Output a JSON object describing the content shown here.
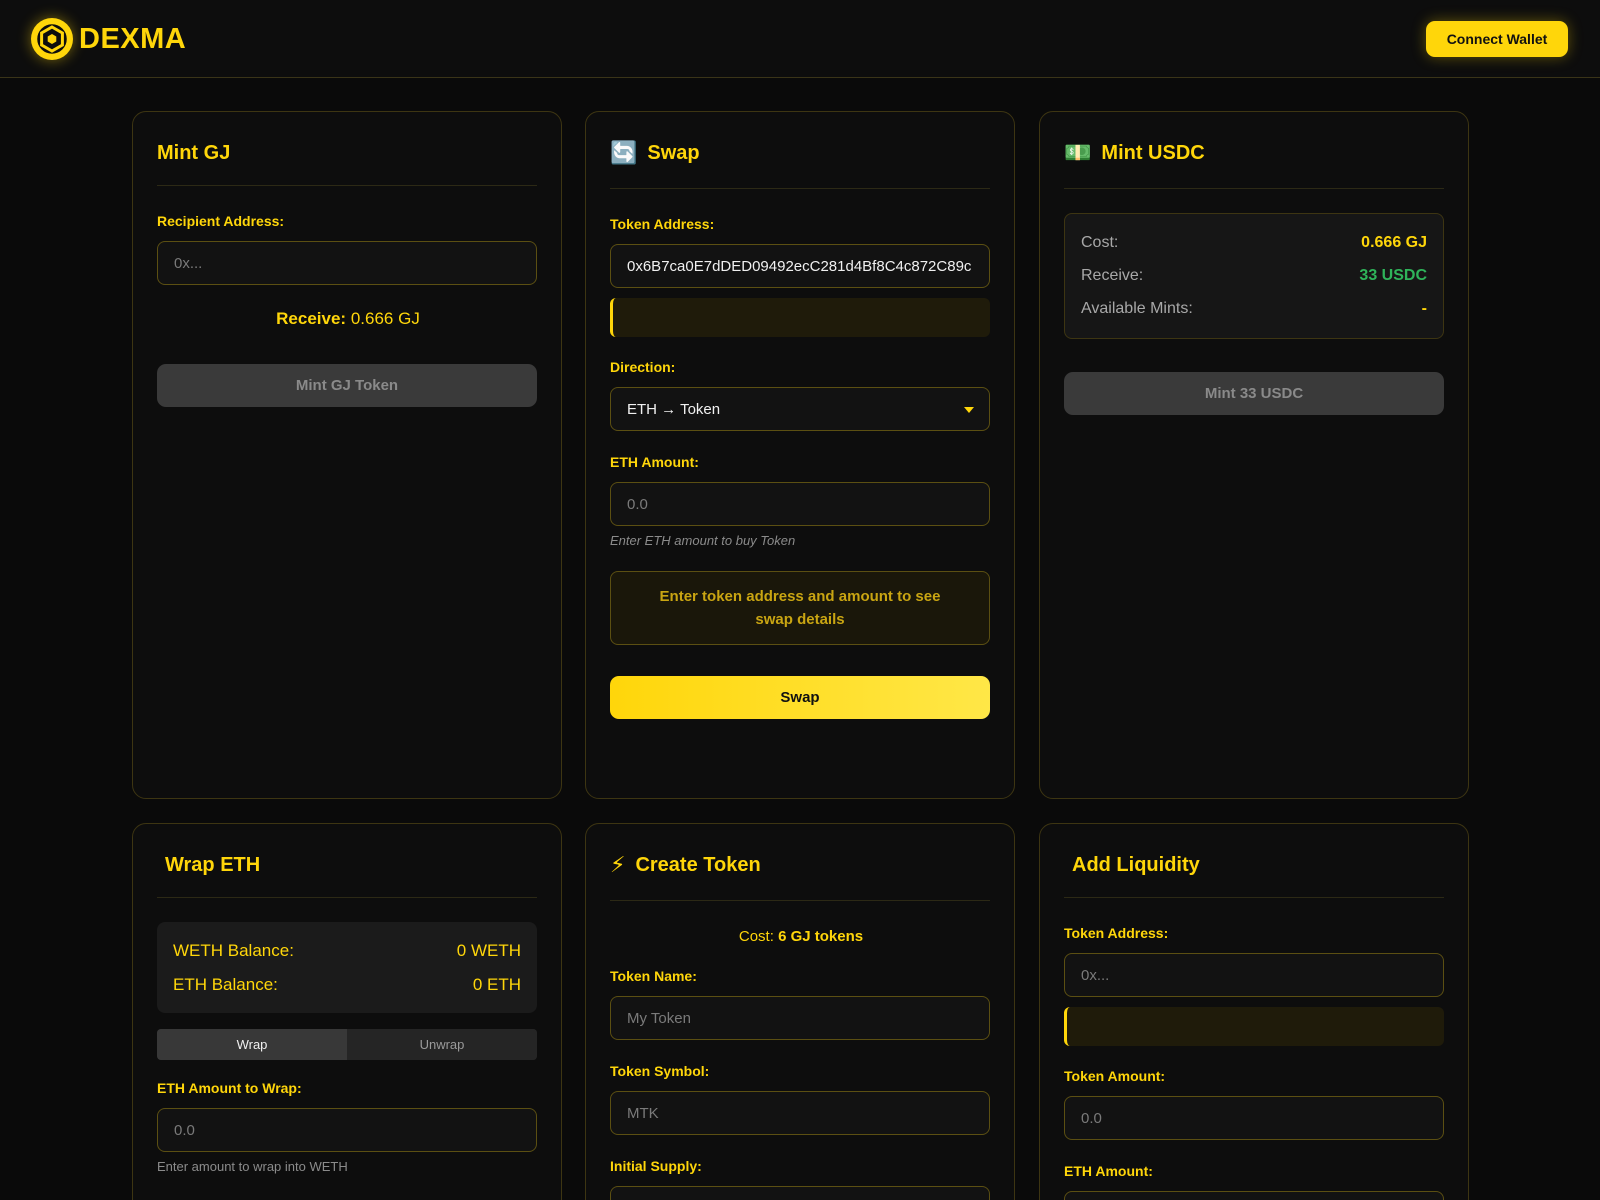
{
  "header": {
    "brand": "DEXMA",
    "connect_label": "Connect Wallet"
  },
  "mint_gj": {
    "title": "Mint GJ",
    "recipient_label": "Recipient Address:",
    "recipient_placeholder": "0x...",
    "receive_label": "Receive:",
    "receive_value": "0.666 GJ",
    "button_label": "Mint GJ Token"
  },
  "swap": {
    "icon": "🔄",
    "title": "Swap",
    "token_address_label": "Token Address:",
    "token_address_value": "0x6B7ca0E7dDED09492ecC281d4Bf8C4c872C89c",
    "direction_label": "Direction:",
    "direction_value": "ETH → Token",
    "eth_amount_label": "ETH Amount:",
    "eth_amount_placeholder": "0.0",
    "eth_amount_hint": "Enter ETH amount to buy Token",
    "notice": "Enter token address and amount to see swap details",
    "button_label": "Swap"
  },
  "mint_usdc": {
    "icon": "💵",
    "title": "Mint USDC",
    "cost_label": "Cost:",
    "cost_value": "0.666 GJ",
    "receive_label": "Receive:",
    "receive_value": "33 USDC",
    "available_label": "Available Mints:",
    "available_value": "-",
    "button_label": "Mint 33 USDC"
  },
  "wrap_eth": {
    "title": "Wrap ETH",
    "weth_label": "WETH Balance:",
    "weth_value": "0 WETH",
    "eth_label": "ETH Balance:",
    "eth_value": "0 ETH",
    "tab_wrap": "Wrap",
    "tab_unwrap": "Unwrap",
    "amount_label": "ETH Amount to Wrap:",
    "amount_placeholder": "0.0",
    "amount_hint": "Enter amount to wrap into WETH"
  },
  "create_token": {
    "icon": "⚡",
    "title": "Create Token",
    "cost_label": "Cost:",
    "cost_value": "6 GJ tokens",
    "name_label": "Token Name:",
    "name_placeholder": "My Token",
    "symbol_label": "Token Symbol:",
    "symbol_placeholder": "MTK",
    "supply_label": "Initial Supply:"
  },
  "add_liquidity": {
    "title": "Add Liquidity",
    "token_address_label": "Token Address:",
    "token_address_placeholder": "0x...",
    "token_amount_label": "Token Amount:",
    "token_amount_placeholder": "0.0",
    "eth_amount_label": "ETH Amount:"
  },
  "colors": {
    "accent": "#ffd60a",
    "background": "#0a0a0a",
    "green": "#2fb45a"
  }
}
